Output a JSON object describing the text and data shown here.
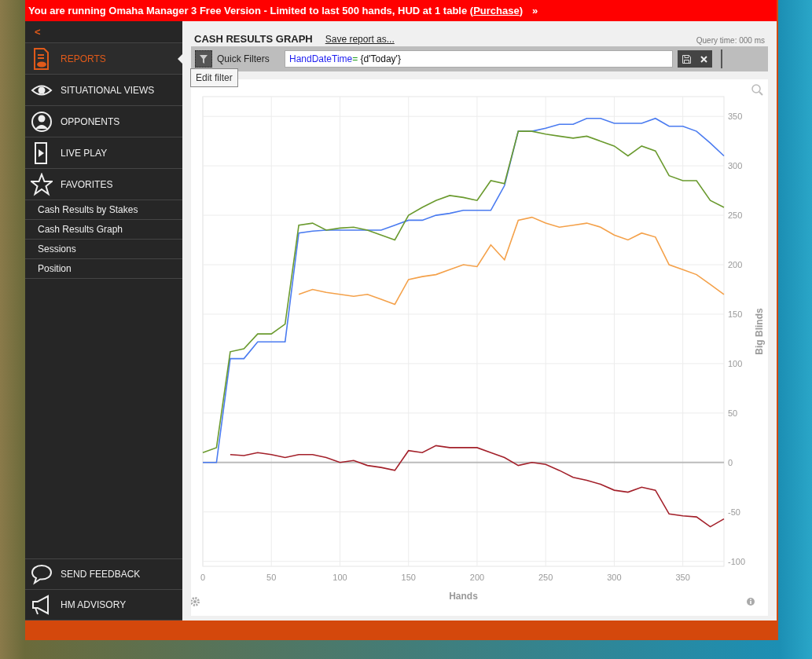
{
  "banner": {
    "text": "You are running Omaha Manager 3 Free Version - Limited to last 500 hands, HUD at 1 table (",
    "link": "Purchase",
    "after": ")",
    "more": "»"
  },
  "sidebar": {
    "back": "<",
    "items": [
      {
        "kind": "reports",
        "label": "REPORTS",
        "selected": true
      },
      {
        "kind": "eye",
        "label": "SITUATIONAL VIEWS",
        "selected": false
      },
      {
        "kind": "person",
        "label": "OPPONENTS",
        "selected": false
      },
      {
        "kind": "live",
        "label": "LIVE PLAY",
        "selected": false
      },
      {
        "kind": "star",
        "label": "FAVORITES",
        "selected": false
      }
    ],
    "favorites": [
      "Cash Results by Stakes",
      "Cash Results Graph",
      "Sessions",
      "Position"
    ],
    "bottom": [
      {
        "kind": "chat",
        "label": "SEND FEEDBACK"
      },
      {
        "kind": "megaphone",
        "label": "HM ADVISORY"
      }
    ]
  },
  "report": {
    "title": "CASH RESULTS GRAPH",
    "save_link": "Save report as...",
    "query_time": "Query time: 000 ms",
    "quick_filters": "Quick Filters",
    "filter": {
      "field": "HandDateTime",
      "operator": "=",
      "value": " {d'Today'}"
    },
    "tooltip": "Edit filter",
    "chart_data": {
      "type": "line",
      "grid": true,
      "xlabel": "Hands",
      "ylabel": "Big Blinds",
      "x": [
        0,
        10,
        20,
        30,
        40,
        50,
        60,
        70,
        80,
        90,
        100,
        110,
        120,
        130,
        140,
        150,
        160,
        170,
        180,
        190,
        200,
        210,
        220,
        230,
        240,
        250,
        260,
        270,
        280,
        290,
        300,
        310,
        320,
        330,
        340,
        350,
        360,
        370,
        380
      ],
      "xlim": [
        0,
        380
      ],
      "ylim": [
        -105,
        370
      ],
      "xticks": [
        0,
        50,
        100,
        150,
        200,
        250,
        300,
        350
      ],
      "yticks": [
        -100,
        -50,
        0,
        50,
        100,
        150,
        200,
        250,
        300,
        350
      ],
      "series": [
        {
          "color": "#4a7bf0",
          "values": [
            0,
            0,
            105,
            105,
            122,
            122,
            122,
            232,
            234,
            235,
            235,
            235,
            235,
            235,
            240,
            245,
            245,
            250,
            252,
            255,
            255,
            255,
            280,
            335,
            335,
            338,
            342,
            342,
            348,
            348,
            343,
            343,
            343,
            348,
            340,
            340,
            335,
            323,
            310
          ]
        },
        {
          "color": "#6a9a2e",
          "values": [
            10,
            15,
            112,
            115,
            130,
            130,
            140,
            240,
            242,
            235,
            237,
            238,
            235,
            230,
            225,
            250,
            258,
            265,
            270,
            268,
            265,
            285,
            282,
            335,
            335,
            332,
            330,
            328,
            330,
            325,
            320,
            310,
            320,
            315,
            290,
            285,
            285,
            265,
            258
          ]
        },
        {
          "color": "#f4a14a",
          "values": [
            null,
            null,
            null,
            null,
            null,
            null,
            null,
            170,
            175,
            172,
            170,
            168,
            170,
            165,
            160,
            185,
            188,
            190,
            195,
            200,
            198,
            220,
            205,
            245,
            248,
            242,
            238,
            240,
            242,
            238,
            230,
            225,
            232,
            228,
            200,
            195,
            190,
            180,
            170
          ]
        },
        {
          "color": "#a3202a",
          "values": [
            null,
            null,
            8,
            7,
            10,
            8,
            5,
            8,
            8,
            5,
            0,
            2,
            -3,
            -5,
            -8,
            12,
            10,
            17,
            15,
            15,
            15,
            10,
            5,
            -3,
            0,
            -2,
            -8,
            -15,
            -18,
            -22,
            -28,
            -30,
            -25,
            -28,
            -52,
            -54,
            -55,
            -65,
            -57
          ]
        }
      ]
    }
  }
}
